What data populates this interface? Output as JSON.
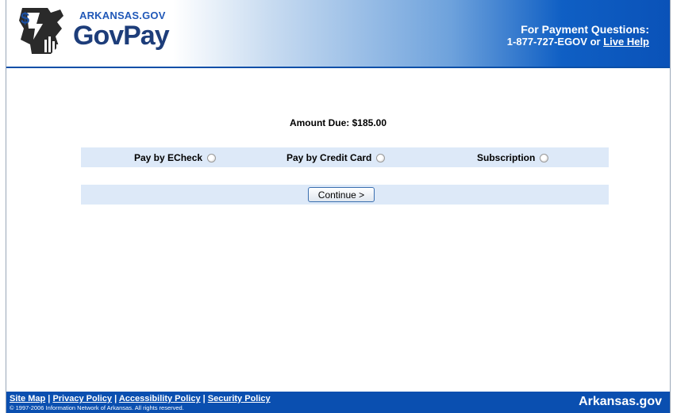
{
  "header": {
    "logo_small": "ARKANSAS.GOV",
    "logo_big": "GovPay",
    "help_title": "For Payment Questions:",
    "help_phone": "1-877-727-EGOV or",
    "help_link": "Live Help"
  },
  "main": {
    "amount_due": "Amount Due: $185.00",
    "options": [
      {
        "label": "Pay by ECheck",
        "selected": false
      },
      {
        "label": "Pay by Credit Card",
        "selected": false
      },
      {
        "label": "Subscription",
        "selected": false
      }
    ],
    "continue_label": "Continue >"
  },
  "footer": {
    "links": [
      "Site Map",
      "Privacy Policy",
      "Accessibility Policy",
      "Security Policy"
    ],
    "separator": "|",
    "copyright": "© 1997-2006 Information Network of Arkansas. All rights reserved.",
    "brand": "Arkansas.gov"
  },
  "colors": {
    "accent": "#0a4fb0",
    "band": "#dde9f8"
  }
}
